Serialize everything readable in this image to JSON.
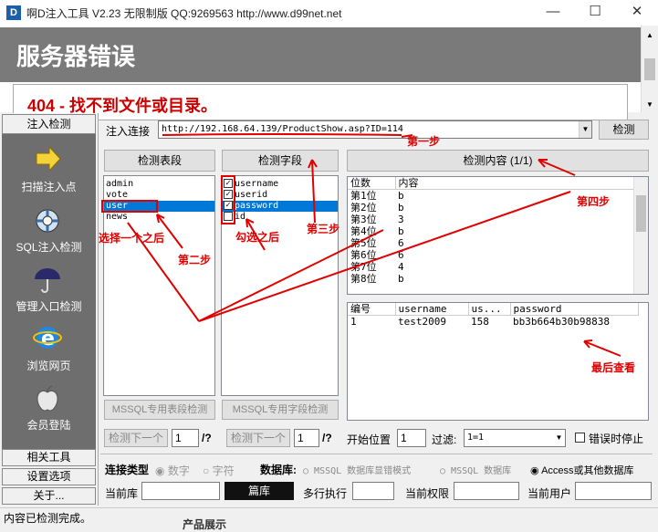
{
  "window": {
    "title": "啊D注入工具 V2.23 无限制版 QQ:9269563 http://www.d99net.net",
    "icon_letter": "D"
  },
  "browser": {
    "heading": "服务器错误",
    "subheading": "404 - 找不到文件或目录。"
  },
  "sidebar": {
    "header": "注入检测",
    "items": [
      {
        "label": "扫描注入点",
        "icon": "arrow-icon"
      },
      {
        "label": "SQL注入检测",
        "icon": "syringe-icon"
      },
      {
        "label": "管理入口检测",
        "icon": "umbrella-icon"
      },
      {
        "label": "浏览网页",
        "icon": "ie-icon"
      },
      {
        "label": "会员登陆",
        "icon": "apple-icon"
      }
    ],
    "bottom_buttons": [
      "相关工具",
      "设置选项",
      "关于..."
    ]
  },
  "toolbar": {
    "inject_label": "注入连接",
    "url": "http://192.168.64.139/ProductShow.asp?ID=114",
    "detect_button": "检测"
  },
  "tables_panel": {
    "button": "检测表段",
    "items": [
      "admin",
      "vote",
      "user",
      "news"
    ],
    "selected": "user",
    "mssql_button": "MSSQL专用表段检测",
    "next_button": "检测下一个",
    "page_value": "1",
    "page_suffix": "/?"
  },
  "fields_panel": {
    "button": "检测字段",
    "items": [
      {
        "name": "username",
        "checked": true
      },
      {
        "name": "userid",
        "checked": true
      },
      {
        "name": "password",
        "checked": true,
        "selected": true
      },
      {
        "name": "id",
        "checked": false
      }
    ],
    "mssql_button": "MSSQL专用字段检测",
    "next_button": "检测下一个",
    "page_value": "1",
    "page_suffix": "/?"
  },
  "content_panel": {
    "button": "检测内容 (1/1)",
    "columns": [
      "位数",
      "内容"
    ],
    "rows": [
      [
        "第1位",
        "b"
      ],
      [
        "第2位",
        "b"
      ],
      [
        "第3位",
        "3"
      ],
      [
        "第4位",
        "b"
      ],
      [
        "第5位",
        "6"
      ],
      [
        "第6位",
        "6"
      ],
      [
        "第7位",
        "4"
      ],
      [
        "第8位",
        "b"
      ]
    ],
    "result_columns": [
      "编号",
      "username",
      "us...",
      "password"
    ],
    "result_rows": [
      [
        "1",
        "test2009",
        "158",
        "bb3b664b30b98838"
      ]
    ]
  },
  "filter": {
    "start_label": "开始位置",
    "start_value": "1",
    "filter_label": "过滤:",
    "filter_value": "1=1",
    "stop_on_error": "错误时停止"
  },
  "conn_type": {
    "label": "连接类型",
    "options": [
      "数字",
      "字符"
    ],
    "db_label": "数据库:",
    "db_options": [
      "MSSQL 数据库显错模式",
      "MSSQL 数据库",
      "Access或其他数据库"
    ]
  },
  "bottom_fields": {
    "current_db": "当前库",
    "dark_button": "篇库",
    "multi_exec": "多行执行",
    "current_perm": "当前权限",
    "current_user": "当前用户"
  },
  "annotations": [
    "第一步",
    "检测表段",
    "选择一个之后",
    "第二步",
    "勾选之后",
    "第三步",
    "第四步",
    "最后查看"
  ],
  "status": {
    "text": "内容已检测完成。",
    "bottom_text": "产品展示"
  }
}
